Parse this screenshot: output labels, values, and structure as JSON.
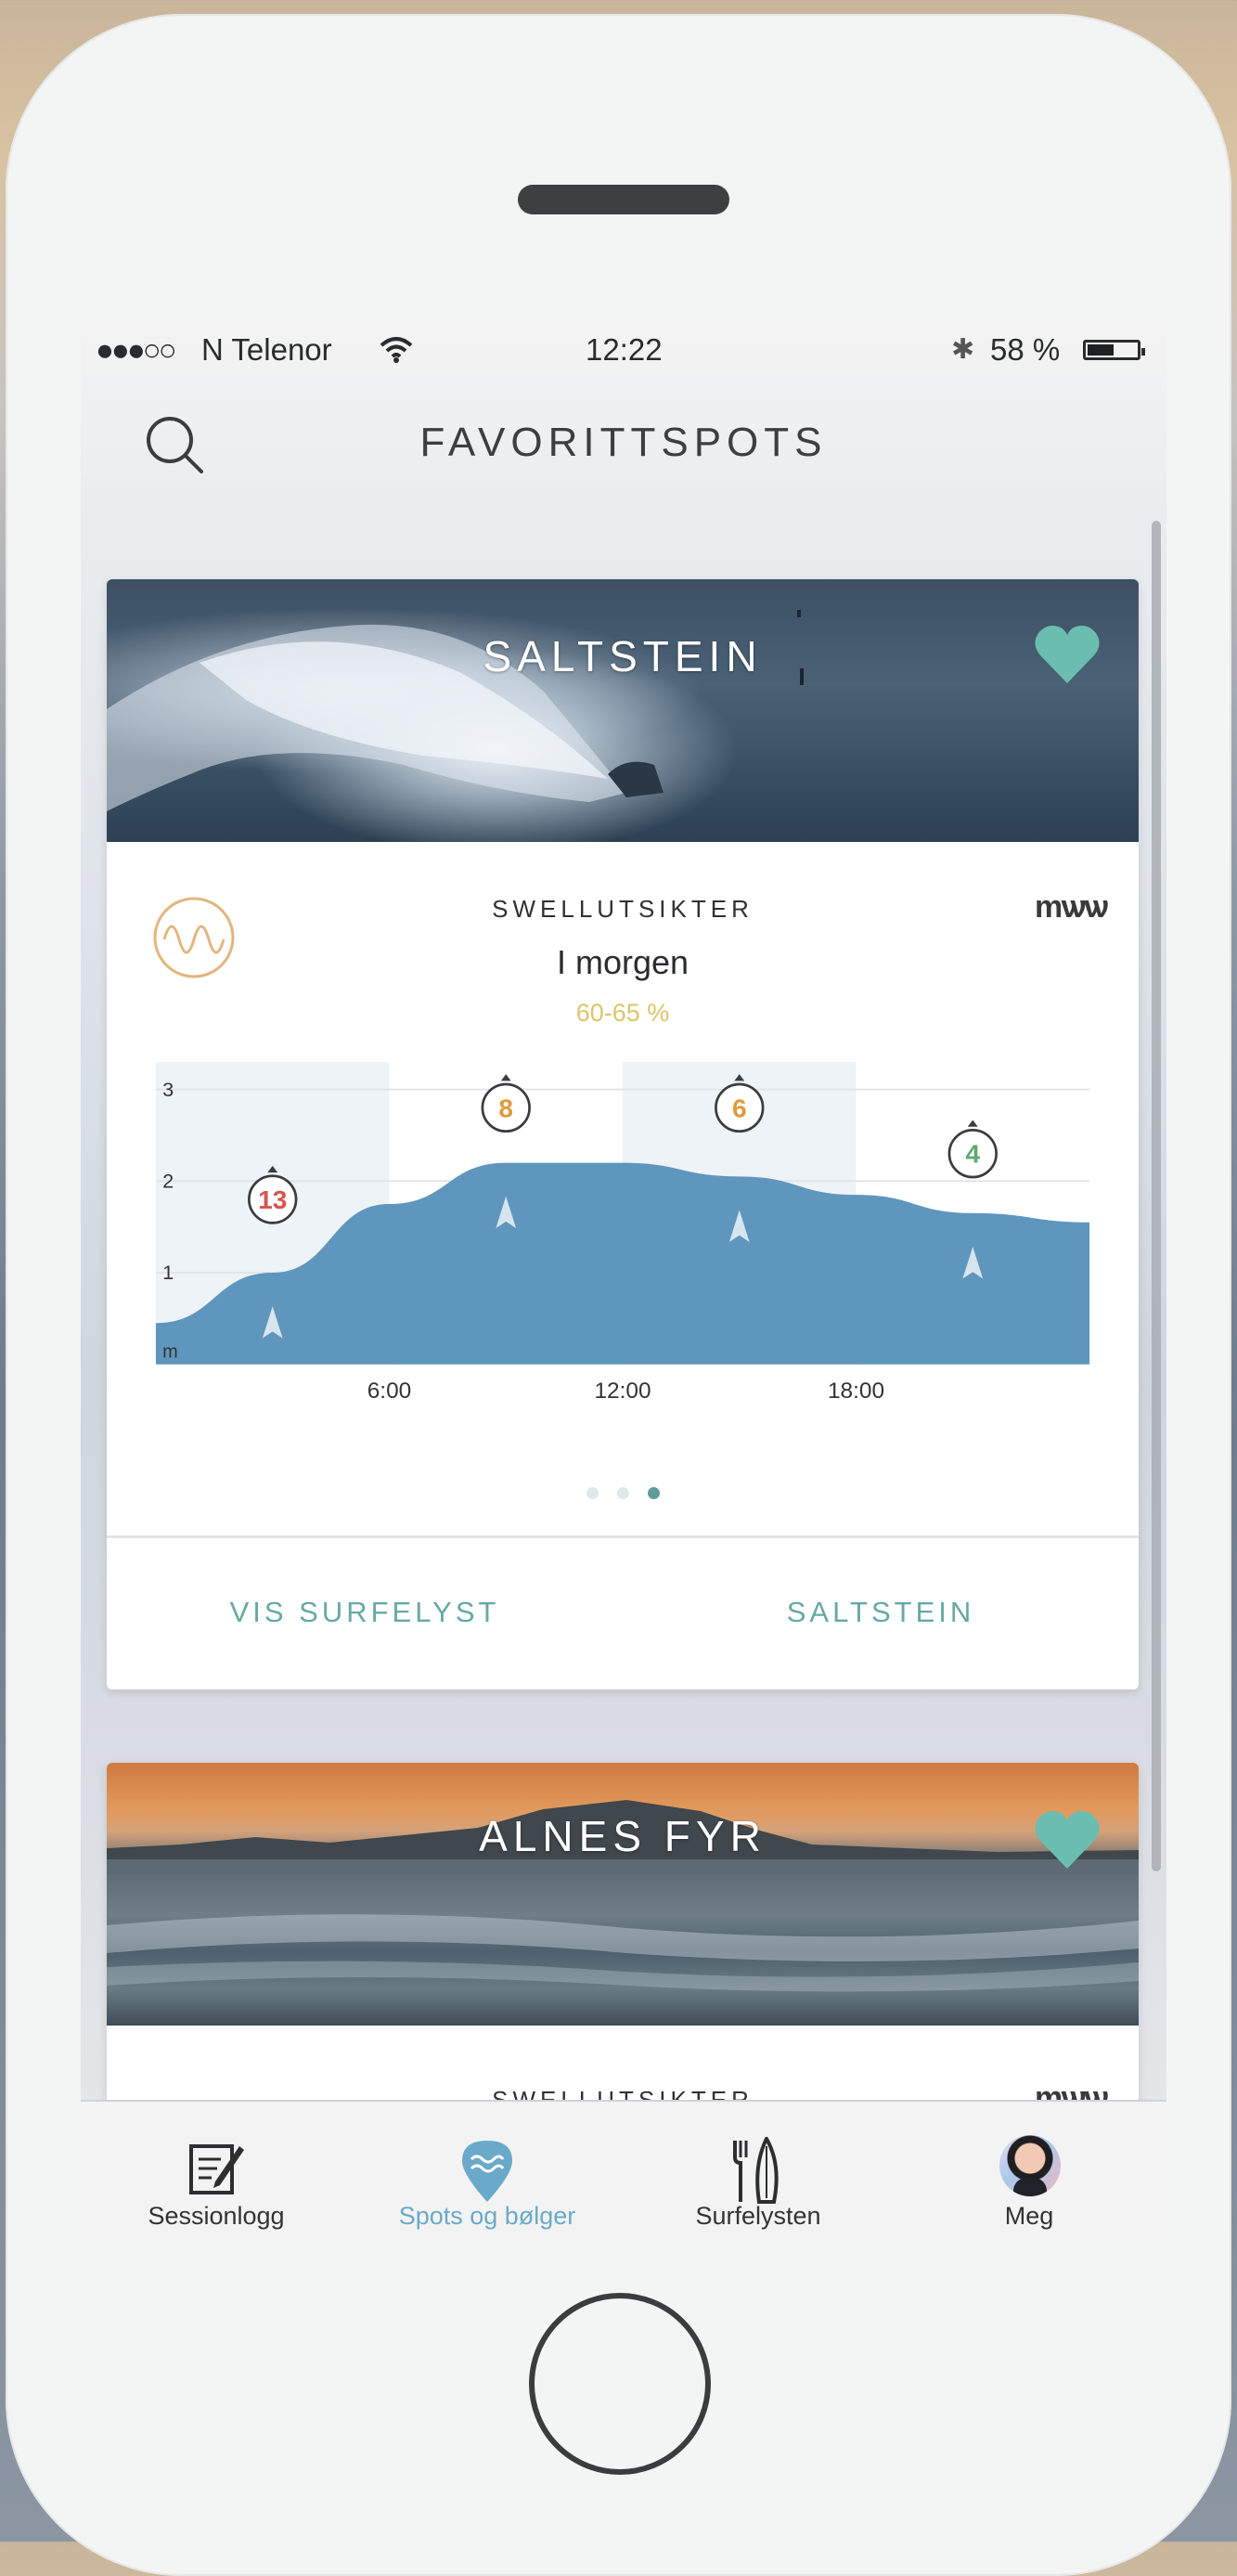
{
  "status_bar": {
    "signal": "●●●○○",
    "carrier": "N Telenor",
    "time": "12:22",
    "bluetooth_icon": "bluetooth-icon",
    "battery": "58 %"
  },
  "header": {
    "title": "FAVORITTSPOTS",
    "search_icon": "search-icon"
  },
  "spots": [
    {
      "name": "SALTSTEIN",
      "favorite": true,
      "section_label": "SWELLUTSIKTER",
      "provider_logo": "mѡѡ",
      "day": "I morgen",
      "confidence": "60-65 %",
      "forecast_chart": {
        "y_ticks": [
          "3",
          "2",
          "1"
        ],
        "y_unit": "m",
        "x_ticks": [
          "6:00",
          "12:00",
          "18:00"
        ],
        "periods": [
          {
            "value": "13",
            "color": "#d9534f"
          },
          {
            "value": "8",
            "color": "#e09a3d"
          },
          {
            "value": "6",
            "color": "#e09a3d"
          },
          {
            "value": "4",
            "color": "#5fa86f"
          }
        ]
      },
      "pager": {
        "pages": 3,
        "active_index": 2
      },
      "actions": {
        "left": "VIS SURFELYST",
        "right": "SALTSTEIN"
      }
    },
    {
      "name": "ALNES FYR",
      "favorite": true,
      "section_label": "SWELLUTSIKTER",
      "provider_logo": "mѡѡ"
    }
  ],
  "chart_data": {
    "type": "area",
    "title": "",
    "xlabel": "",
    "ylabel": "m",
    "x": [
      0,
      3,
      6,
      9,
      12,
      15,
      18,
      21,
      24
    ],
    "values": [
      0.45,
      1.0,
      1.75,
      2.2,
      2.2,
      2.05,
      1.85,
      1.65,
      1.55
    ],
    "ylim": [
      0,
      3.3
    ],
    "xlim": [
      0,
      24
    ],
    "x_ticks": [
      "6:00",
      "12:00",
      "18:00"
    ],
    "y_ticks": [
      1,
      2,
      3
    ],
    "annotations": [
      {
        "x": 3,
        "y": 1.8,
        "label": "13",
        "direction_deg": 200
      },
      {
        "x": 9,
        "y": 2.8,
        "label": "8",
        "direction_deg": 210
      },
      {
        "x": 15,
        "y": 2.8,
        "label": "6",
        "direction_deg": 200
      },
      {
        "x": 21,
        "y": 2.3,
        "label": "4",
        "direction_deg": 200
      }
    ],
    "grid": true
  },
  "tab_bar": {
    "items": [
      {
        "label": "Sessionlogg",
        "icon": "notebook-icon",
        "active": false
      },
      {
        "label": "Spots og bølger",
        "icon": "map-pin-wave-icon",
        "active": true
      },
      {
        "label": "Surfelysten",
        "icon": "surfboard-icon",
        "active": false
      },
      {
        "label": "Meg",
        "icon": "avatar",
        "active": false
      }
    ]
  },
  "colors": {
    "accent_teal": "#66a9a4",
    "heart": "#6bbdb0",
    "wave_area": "#5f96bd",
    "tab_active": "#6aa9c9",
    "confidence_text": "#dcc46a"
  }
}
